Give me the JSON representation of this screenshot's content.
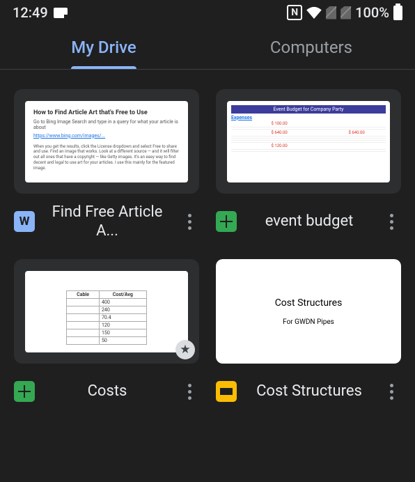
{
  "status_bar": {
    "time": "12:49",
    "battery": "100%"
  },
  "tabs": [
    {
      "label": "My Drive",
      "active": true
    },
    {
      "label": "Computers",
      "active": false
    }
  ],
  "files": [
    {
      "name": "Find Free Article A...",
      "type": "docs",
      "icon_letter": "W",
      "doc_preview": {
        "title": "How to Find Article Art that's Free to Use",
        "line1": "Go to Bing Image Search and type in a query for what your article is about",
        "link": "https://www.bing.com/images/...",
        "para": "When you get the results, click the License dropdown and select Free to share and use. Find an image that works. Look at a different source — and it will filter out all ones that have a copyright — like Getty images. It's an easy way to find decent and legal to use art for your articles. I use this mainly for the featured image."
      }
    },
    {
      "name": "event budget",
      "type": "sheets",
      "sheet_preview": {
        "header": "Event Budget for Company Party",
        "section": "Expenses"
      }
    },
    {
      "name": "Costs",
      "type": "sheets",
      "starred": true,
      "cost_preview": {
        "headers": [
          "Cable",
          "Cost/Avg"
        ]
      }
    },
    {
      "name": "Cost Structures",
      "type": "slides",
      "slide_preview": {
        "title": "Cost Structures",
        "subtitle": "For GWDN Pipes"
      }
    }
  ]
}
